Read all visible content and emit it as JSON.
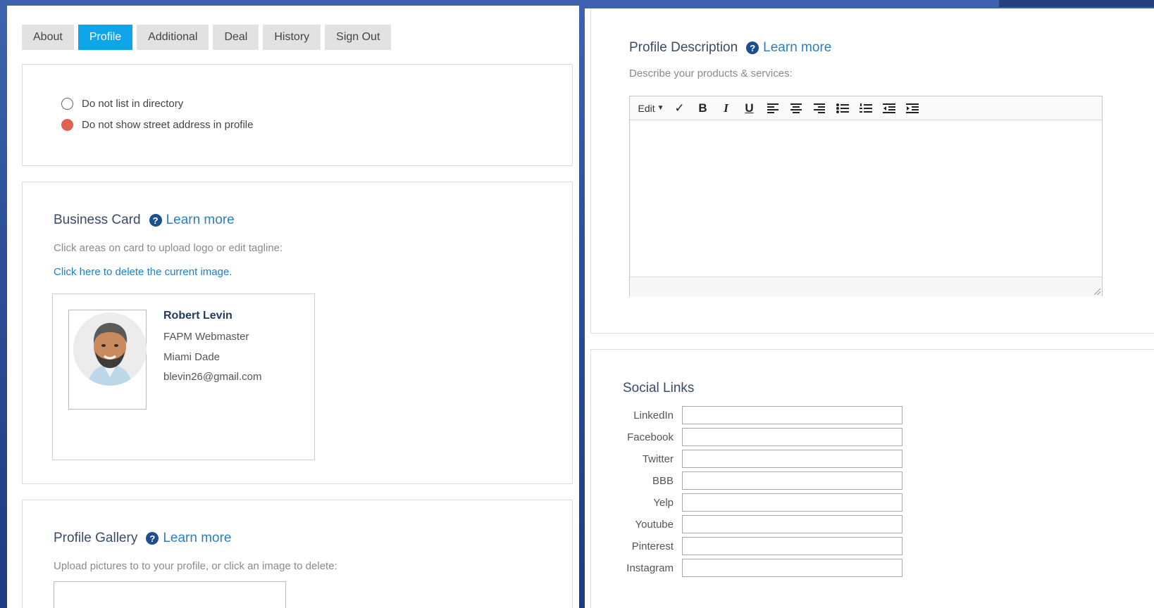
{
  "tabs": [
    {
      "label": "About",
      "active": false
    },
    {
      "label": "Profile",
      "active": true
    },
    {
      "label": "Additional",
      "active": false
    },
    {
      "label": "Deal",
      "active": false
    },
    {
      "label": "History",
      "active": false
    },
    {
      "label": "Sign Out",
      "active": false
    }
  ],
  "privacy": {
    "options": [
      {
        "label": "Do not list in directory",
        "checked": false
      },
      {
        "label": "Do not show street address in profile",
        "checked": true
      }
    ]
  },
  "business_card": {
    "title": "Business Card",
    "learn_more": "Learn more",
    "hint": "Click areas on card to upload logo or edit tagline:",
    "delete_link": "Click here to delete the current image.",
    "name": "Robert Levin",
    "line1": "FAPM Webmaster",
    "line2": "Miami Dade",
    "email": "blevin26@gmail.com"
  },
  "gallery": {
    "title": "Profile Gallery",
    "learn_more": "Learn more",
    "hint": "Upload pictures to to your profile, or click an image to delete:"
  },
  "description": {
    "title": "Profile Description",
    "learn_more": "Learn more",
    "hint": "Describe your products & services:",
    "edit_menu": "Edit"
  },
  "social": {
    "title": "Social Links",
    "links": [
      {
        "label": "LinkedIn",
        "value": ""
      },
      {
        "label": "Facebook",
        "value": ""
      },
      {
        "label": "Twitter",
        "value": ""
      },
      {
        "label": "BBB",
        "value": ""
      },
      {
        "label": "Yelp",
        "value": ""
      },
      {
        "label": "Youtube",
        "value": ""
      },
      {
        "label": "Pinterest",
        "value": ""
      },
      {
        "label": "Instagram",
        "value": ""
      }
    ]
  },
  "colors": {
    "accent": "#0ea5e9",
    "radio_checked": "#e0614f",
    "link": "#1f7fc7"
  }
}
